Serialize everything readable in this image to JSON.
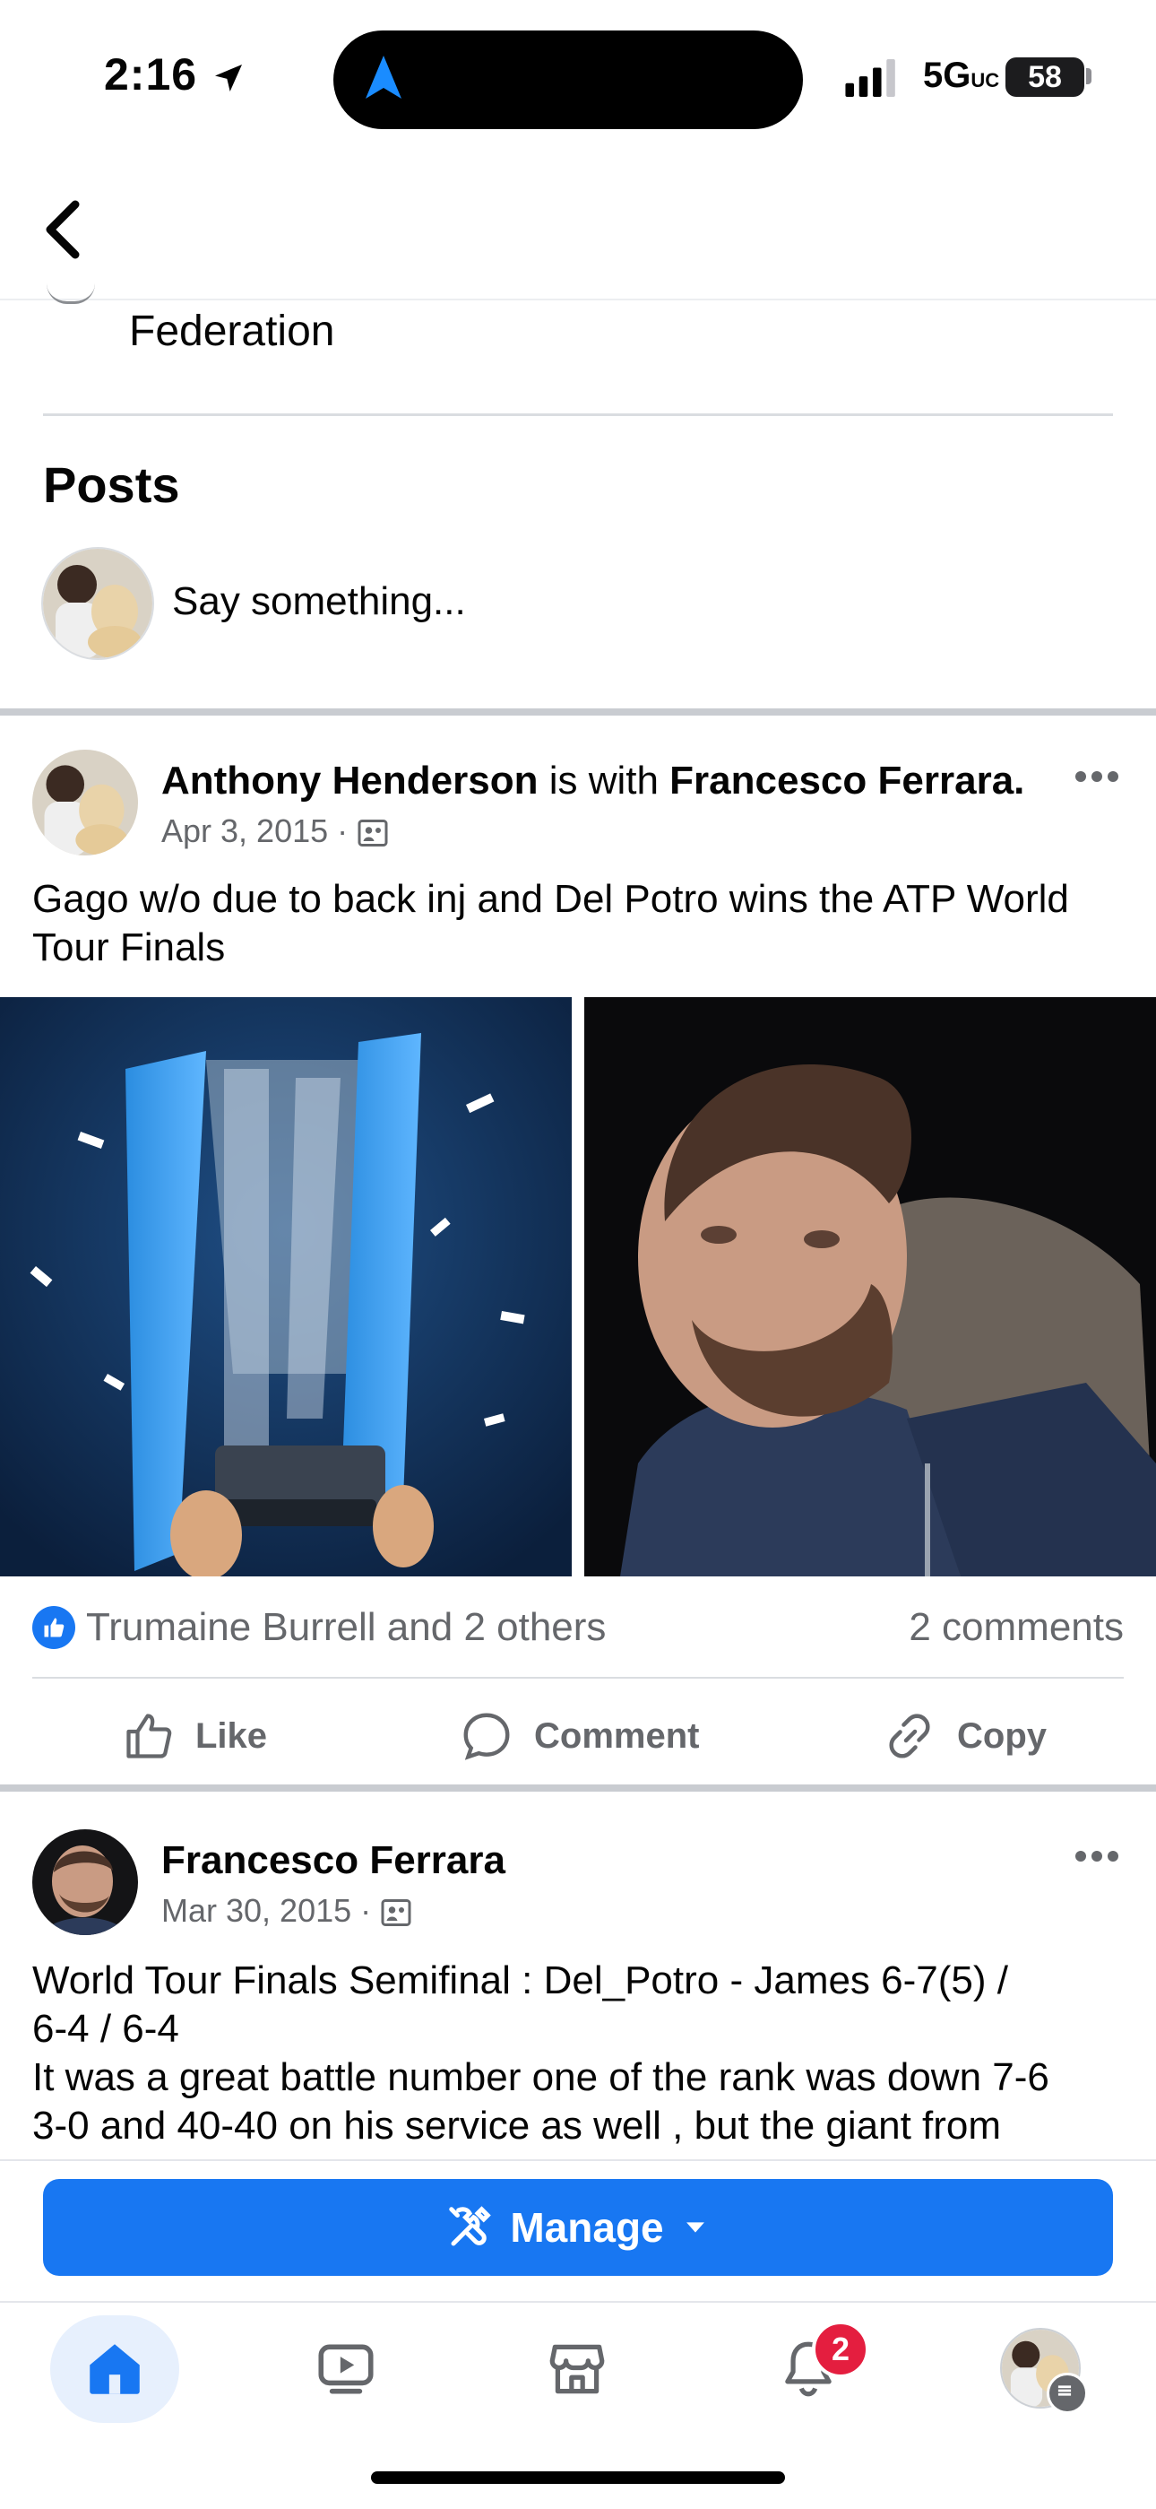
{
  "status_bar": {
    "time": "2:16",
    "network": "5G",
    "network_suffix": "UC",
    "battery": "58"
  },
  "header": {
    "back_label": "Back"
  },
  "intro": {
    "federation_text": "Federation"
  },
  "posts_section": {
    "heading": "Posts",
    "composer_placeholder": "Say something..."
  },
  "posts": [
    {
      "author": "Anthony Henderson",
      "with_text": "is with",
      "tagged": "Francesco Ferrara.",
      "date": "Apr 3, 2015",
      "dot": "·",
      "text": "Gago w/o due to back inj and Del Potro wins the ATP World Tour Finals",
      "reactions_text": "Trumaine Burrell and 2 others",
      "comments_text": "2 comments",
      "actions": {
        "like": "Like",
        "comment": "Comment",
        "copy": "Copy"
      }
    },
    {
      "author": "Francesco Ferrara",
      "date": "Mar 30, 2015",
      "dot": "·",
      "text_line1": "World Tour Finals Semifinal : Del_Potro - James  6-7(5) /",
      "text_line2": "6-4 / 6-4",
      "text_line3": "It was a great battle number one of the rank was down 7-6",
      "text_line4": "3-0 and 40-40 on his service as well , but the giant from"
    }
  ],
  "manage": {
    "label": "Manage"
  },
  "tabbar": {
    "notifications_count": "2"
  },
  "colors": {
    "accent": "#1877f2",
    "badge": "#e41e3f",
    "muted_text": "#65676b"
  }
}
